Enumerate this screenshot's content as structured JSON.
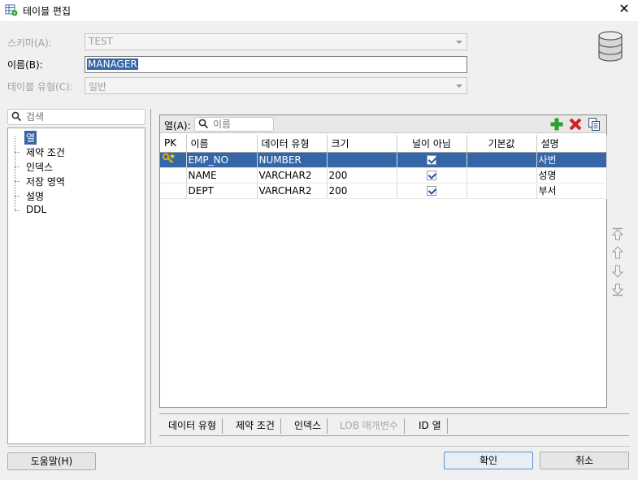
{
  "window": {
    "title": "테이블 편집"
  },
  "form": {
    "schema": {
      "label": "스키마(A):",
      "value": "TEST"
    },
    "name": {
      "label": "이름(B):",
      "value": "MANAGER"
    },
    "table_type": {
      "label": "테이블 유형(C):",
      "value": "일반"
    }
  },
  "nav": {
    "search_placeholder": "검색",
    "items": [
      "열",
      "제약 조건",
      "인덱스",
      "저장 영역",
      "설명",
      "DDL"
    ],
    "selected": "열"
  },
  "columns_panel": {
    "label": "열(A):",
    "search_placeholder": "이름",
    "headers": [
      "PK",
      "이름",
      "데이터 유형",
      "크기",
      "널이 아님",
      "기본값",
      "설명"
    ],
    "rows": [
      {
        "pk": true,
        "name": "EMP_NO",
        "type": "NUMBER",
        "size": "",
        "not_null": true,
        "default": "",
        "comment": "사번"
      },
      {
        "pk": false,
        "name": "NAME",
        "type": "VARCHAR2",
        "size": "200",
        "not_null": true,
        "default": "",
        "comment": "성명"
      },
      {
        "pk": false,
        "name": "DEPT",
        "type": "VARCHAR2",
        "size": "200",
        "not_null": true,
        "default": "",
        "comment": "부서"
      }
    ],
    "selected_row": 0
  },
  "bottom_tabs": [
    "데이터 유형",
    "제약 조건",
    "인덱스",
    "LOB 매개변수",
    "ID 열"
  ],
  "buttons": {
    "help": "도움말(H)",
    "ok": "확인",
    "cancel": "취소"
  },
  "colors": {
    "selection": "#3466a8",
    "add_icon": "#2da02d",
    "delete_icon": "#d42020"
  }
}
